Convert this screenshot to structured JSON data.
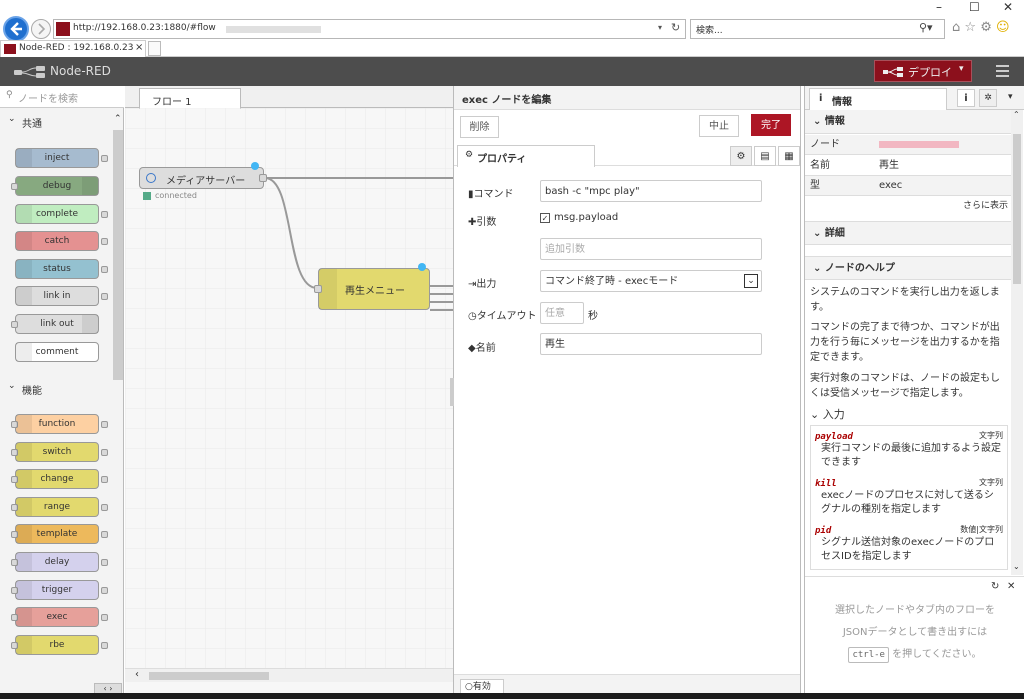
{
  "browser": {
    "url_prefix": "http://192.168.0.23:1880/#flow",
    "search_placeholder": "検索...",
    "tab_title": "Node-RED : 192.168.0.23",
    "tab_close": "×"
  },
  "header": {
    "app_name": "Node-RED",
    "deploy_label": "デプロイ",
    "menu_icon": "hamburger-icon"
  },
  "palette": {
    "search_placeholder": "ノードを検索",
    "categories": [
      {
        "label": "共通",
        "nodes": [
          "inject",
          "debug",
          "complete",
          "catch",
          "status",
          "link in",
          "link out",
          "comment"
        ]
      },
      {
        "label": "機能",
        "nodes": [
          "function",
          "switch",
          "change",
          "range",
          "template",
          "delay",
          "trigger",
          "exec",
          "rbe"
        ]
      }
    ]
  },
  "workspace": {
    "tab_label": "フロー 1",
    "node1_label": "メディアサーバー",
    "node1_status": "connected",
    "node2_label": "再生メニュー"
  },
  "editor": {
    "title": "exec ノードを編集",
    "delete_label": "削除",
    "cancel_label": "中止",
    "done_label": "完了",
    "tab_properties": "プロパティ",
    "command_label": "コマンド",
    "command_value": "bash -c \"mpc play\"",
    "append_label": "引数",
    "append_checkbox_label": "msg.payload",
    "append_extra_placeholder": "追加引数",
    "output_label": "出力",
    "output_value": "コマンド終了時 - execモード",
    "timeout_label": "タイムアウト",
    "timeout_placeholder": "任意",
    "timeout_unit": "秒",
    "name_label": "名前",
    "name_value": "再生",
    "enabled_label": "有効"
  },
  "sidebar": {
    "tab_info": "情報",
    "section_info": "情報",
    "rows": [
      {
        "key": "ノード",
        "value": ""
      },
      {
        "key": "名前",
        "value": "再生"
      },
      {
        "key": "型",
        "value": "exec"
      }
    ],
    "show_more": "さらに表示",
    "section_details": "詳細",
    "section_help": "ノードのヘルプ",
    "help_p1": "システムのコマンドを実行し出力を返します。",
    "help_p2": "コマンドの完了まで待つか、コマンドが出力を行う毎にメッセージを出力するかを指定できます。",
    "help_p3": "実行対象のコマンドは、ノードの設定もしくは受信メッセージで指定します。",
    "inputs_heading": "入力",
    "inputs": [
      {
        "name": "payload",
        "type": "文字列",
        "desc": "実行コマンドの最後に追加するよう設定できます"
      },
      {
        "name": "kill",
        "type": "文字列",
        "desc": "execノードのプロセスに対して送るシグナルの種別を指定します"
      },
      {
        "name": "pid",
        "type": "数値|文字列",
        "desc": "シグナル送信対象のexecノードのプロセスIDを指定します"
      }
    ],
    "bottom_text1": "選択したノードやタブ内のフローを",
    "bottom_text2": "JSONデータとして書き出すには",
    "bottom_key": "ctrl-e",
    "bottom_text3": "を押してください。"
  },
  "colors": {
    "header_bg": "#4d4d4d",
    "deploy_bg": "#8c101c",
    "done_bg": "#ad1625",
    "node_port": "#42b6f4"
  }
}
